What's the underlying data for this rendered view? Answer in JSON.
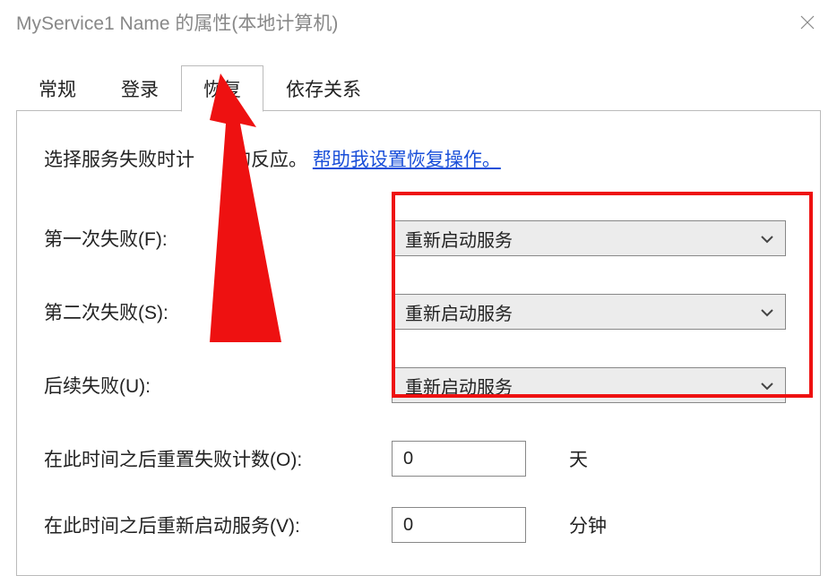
{
  "window": {
    "title": "MyService1 Name 的属性(本地计算机)"
  },
  "tabs": {
    "general": "常规",
    "logon": "登录",
    "recovery": "恢复",
    "dependencies": "依存关系"
  },
  "intro": {
    "prefix": "选择服务失败时计",
    "suffix": "的反应。",
    "link": "帮助我设置恢复操作。"
  },
  "labels": {
    "first_failure": "第一次失败(F):",
    "second_failure": "第二次失败(S):",
    "subsequent_failures": "后续失败(U):",
    "reset_fail_count": "在此时间之后重置失败计数(O):",
    "restart_after": "在此时间之后重新启动服务(V):"
  },
  "values": {
    "first_failure": "重新启动服务",
    "second_failure": "重新启动服务",
    "subsequent_failures": "重新启动服务",
    "reset_days": "0",
    "restart_minutes": "0"
  },
  "units": {
    "days": "天",
    "minutes": "分钟"
  }
}
